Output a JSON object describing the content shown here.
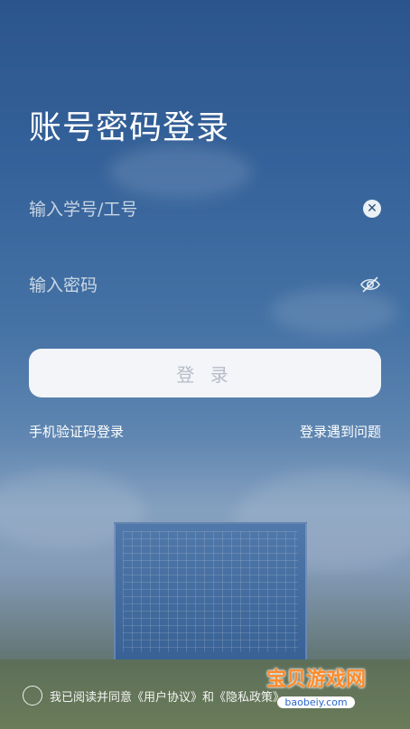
{
  "title": "账号密码登录",
  "username": {
    "placeholder": "输入学号/工号",
    "value": ""
  },
  "password": {
    "placeholder": "输入密码",
    "value": ""
  },
  "login_button": "登 录",
  "links": {
    "sms_login": "手机验证码登录",
    "problem": "登录遇到问题"
  },
  "agreement": {
    "prefix": "我已阅读并同意",
    "user_agreement": "《用户协议》",
    "and": "和",
    "privacy_policy": "《隐私政策》"
  },
  "watermark": {
    "logo_text": "宝贝游戏网",
    "site": "baobeiy.com"
  },
  "colors": {
    "accent_bg": "#3a6aa3",
    "button_bg": "#f3f5f9",
    "button_text": "#b7bcc6"
  },
  "icons": {
    "clear": "clear-icon",
    "eye": "eye-hidden-icon"
  }
}
